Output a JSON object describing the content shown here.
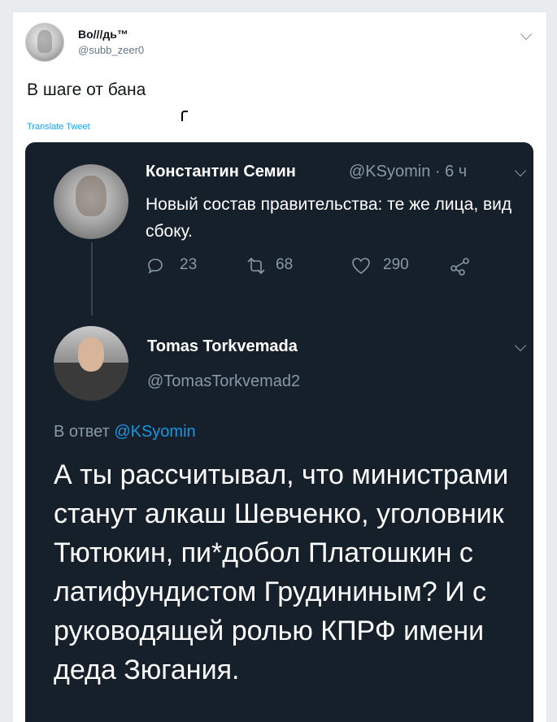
{
  "outer_tweet": {
    "display_name": "Во///дь™",
    "handle": "@subb_zeer0",
    "text": "В шаге от бана",
    "translate_label": "Translate Tweet"
  },
  "quoted": {
    "tweet1": {
      "name": "Константин Семин",
      "handle_time": "@KSyomin · 6 ч",
      "text": "Новый состав правительства: те же лица, вид сбоку.",
      "reply_count": "23",
      "retweet_count": "68",
      "like_count": "290"
    },
    "tweet2": {
      "name": "Tomas Torkvemada",
      "handle": "@TomasTorkvemad2",
      "reply_prefix": "В ответ",
      "reply_mention": "@KSyomin",
      "text": "А ты рассчитывал, что министрами станут алкаш Шевченко, уголовник Тютюкин, пи*добол Платошкин с латифундистом Грудининым? И с руководящей ролью КПРФ имени деда Зюгания."
    }
  },
  "colors": {
    "dark_bg": "#15202b",
    "muted": "#8899a6",
    "link": "#1da1f2"
  }
}
